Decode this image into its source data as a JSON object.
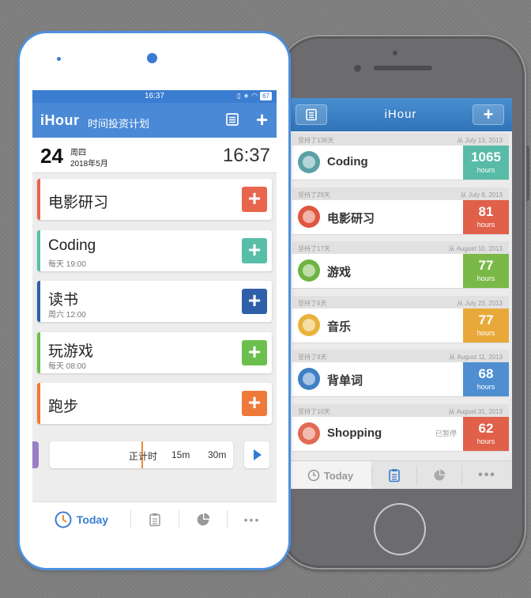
{
  "iphone": {
    "title": "iHour",
    "cards": [
      {
        "streak": "坚持了136天",
        "since": "从 July 13, 2013",
        "name": "Coding",
        "hours": "1065",
        "unit": "hours",
        "color": "#57bba7",
        "icon": "lab-flask-icon",
        "icon_color": "#5aa0a6",
        "paused": ""
      },
      {
        "streak": "坚持了29天",
        "since": "从 July 8, 2013",
        "name": "电影研习",
        "hours": "81",
        "unit": "hours",
        "color": "#e0604a",
        "icon": "clapperboard-icon",
        "icon_color": "#e0563f",
        "paused": ""
      },
      {
        "streak": "坚持了17天",
        "since": "从 August 10, 2013",
        "name": "游戏",
        "hours": "77",
        "unit": "hours",
        "color": "#7ab948",
        "icon": "gamepad-icon",
        "icon_color": "#6fb442",
        "paused": ""
      },
      {
        "streak": "坚持了6天",
        "since": "从 July 23, 2013",
        "name": "音乐",
        "hours": "77",
        "unit": "hours",
        "color": "#e9a93a",
        "icon": "music-disc-icon",
        "icon_color": "#e9b33a",
        "paused": ""
      },
      {
        "streak": "坚持了9天",
        "since": "从 August 11, 2013",
        "name": "背单词",
        "hours": "68",
        "unit": "hours",
        "color": "#4f8fd1",
        "icon": "book-icon",
        "icon_color": "#3f7fc5",
        "paused": ""
      },
      {
        "streak": "坚持了10天",
        "since": "从 August 31, 2013",
        "name": "Shopping",
        "hours": "62",
        "unit": "hours",
        "color": "#e0604a",
        "icon": "map-icon",
        "icon_color": "#e36a52",
        "paused": "已暂停"
      }
    ],
    "tabs": {
      "today": "Today"
    }
  },
  "android": {
    "status_time": "16:37",
    "battery": "67",
    "brand": "iHour",
    "subtitle": "时间投资计划",
    "date": {
      "day": "24",
      "weekday": "周四",
      "month": "2018年5月",
      "clock": "16:37"
    },
    "tasks": [
      {
        "name": "电影研习",
        "sub": "",
        "color": "#e8664d"
      },
      {
        "name": "Coding",
        "sub": "每天 19:00",
        "color": "#59bea8"
      },
      {
        "name": "读书",
        "sub": "周六 12:00",
        "color": "#2f5fa8"
      },
      {
        "name": "玩游戏",
        "sub": "每天 08:00",
        "color": "#6cbf4c"
      },
      {
        "name": "跑步",
        "sub": "",
        "color": "#ee7a3a"
      }
    ],
    "timer": {
      "label_count": "正计时",
      "label_15": "15m",
      "label_30": "30m"
    },
    "tabs": {
      "today": "Today"
    }
  }
}
